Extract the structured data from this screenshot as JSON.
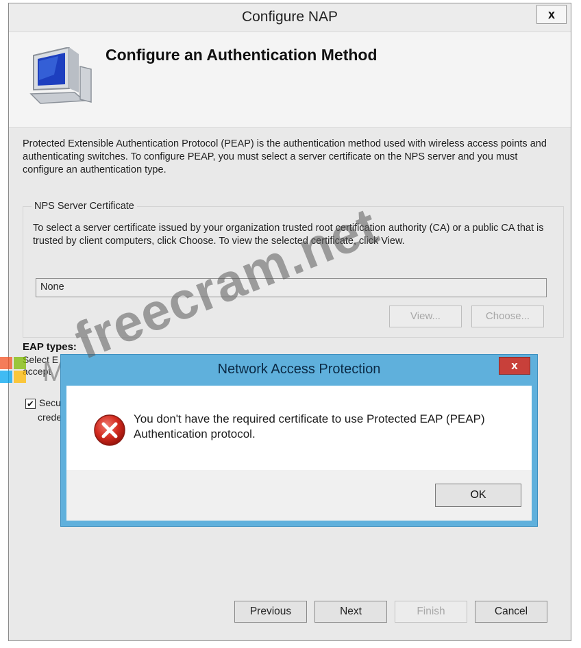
{
  "window": {
    "title": "Configure NAP",
    "close_label": "x"
  },
  "header": {
    "title": "Configure an Authentication Method",
    "icon": "monitor-icon"
  },
  "description": "Protected Extensible Authentication Protocol (PEAP) is the authentication method used with wireless access points and authenticating switches. To configure PEAP, you must select a server certificate on the NPS server and you must configure an authentication type.",
  "nps_group": {
    "label": "NPS Server Certificate",
    "text": "To select a server certificate issued by your organization trusted root certification authority (CA) or a public CA that is trusted by client computers, click Choose. To view the selected certificate, click View.",
    "field_value": "None",
    "view_label": "View...",
    "choose_label": "Choose..."
  },
  "eap": {
    "title": "EAP types:",
    "fragment_line1": "Select E",
    "fragment_line2": "accept",
    "check_label_fragment": "Secu",
    "cred_fragment": "crede",
    "checked": true
  },
  "watermark": {
    "brand": "Microsoft",
    "site": "freecram.net",
    "colors": [
      "#f25022",
      "#7fba00",
      "#00a4ef",
      "#ffb900"
    ]
  },
  "dialog": {
    "title": "Network Access Protection",
    "close_label": "x",
    "message_line1": "You don't have the required certificate to use Protected EAP (PEAP)",
    "message_line2": "Authentication protocol.",
    "ok_label": "OK",
    "icon": "error-icon",
    "accent": "#5fb0dc"
  },
  "footer": {
    "previous": "Previous",
    "next": "Next",
    "finish": "Finish",
    "cancel": "Cancel"
  }
}
